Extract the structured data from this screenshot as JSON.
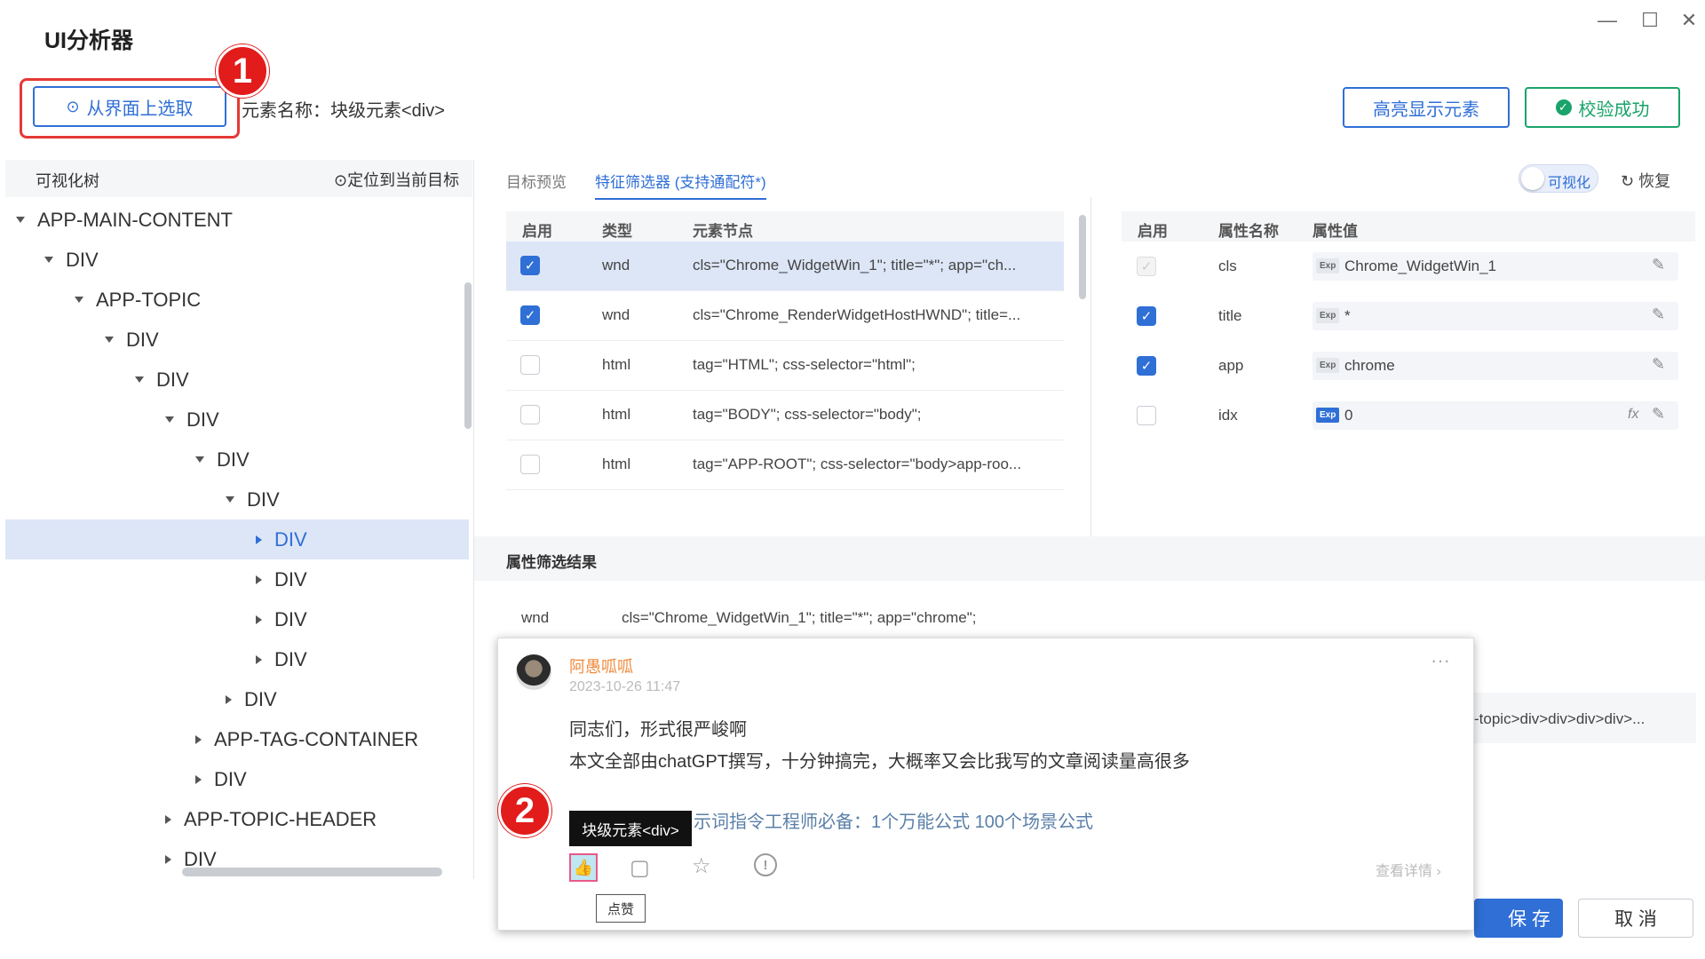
{
  "app_title": "UI分析器",
  "window_controls": [
    "—",
    "☐",
    "✕"
  ],
  "pick_button": "从界面上选取",
  "element_name": "元素名称：块级元素<div>",
  "highlight_button": "高亮显示元素",
  "verify_button": "校验成功",
  "markers": {
    "one": "1",
    "two": "2"
  },
  "tree": {
    "title": "可视化树",
    "locate": "定位到当前目标",
    "items": [
      {
        "label": "APP-MAIN-CONTENT",
        "caret": "down"
      },
      {
        "label": "DIV",
        "caret": "down"
      },
      {
        "label": "APP-TOPIC",
        "caret": "down"
      },
      {
        "label": "DIV",
        "caret": "down"
      },
      {
        "label": "DIV",
        "caret": "down"
      },
      {
        "label": "DIV",
        "caret": "down"
      },
      {
        "label": "DIV",
        "caret": "down"
      },
      {
        "label": "DIV",
        "caret": "down"
      },
      {
        "label": "DIV",
        "caret": "right",
        "selected": true
      },
      {
        "label": "DIV",
        "caret": "right"
      },
      {
        "label": "DIV",
        "caret": "right"
      },
      {
        "label": "DIV",
        "caret": "right"
      },
      {
        "label": "DIV",
        "caret": "right"
      },
      {
        "label": "APP-TAG-CONTAINER",
        "caret": "right"
      },
      {
        "label": "DIV",
        "caret": "right"
      },
      {
        "label": "APP-TOPIC-HEADER",
        "caret": "right"
      },
      {
        "label": "DIV",
        "caret": "right"
      }
    ]
  },
  "tabs": {
    "preview": "目标预览",
    "filter": "特征筛选器 (支持通配符*)"
  },
  "visualize_toggle": "可视化",
  "restore": "恢复",
  "node_table": {
    "headers": [
      "启用",
      "类型",
      "元素节点"
    ],
    "rows": [
      {
        "checked": true,
        "type": "wnd",
        "node": "cls=\"Chrome_WidgetWin_1\"; title=\"*\"; app=\"ch..."
      },
      {
        "checked": true,
        "type": "wnd",
        "node": "cls=\"Chrome_RenderWidgetHostHWND\"; title=..."
      },
      {
        "checked": false,
        "type": "html",
        "node": "tag=\"HTML\"; css-selector=\"html\";"
      },
      {
        "checked": false,
        "type": "html",
        "node": "tag=\"BODY\"; css-selector=\"body\";"
      },
      {
        "checked": false,
        "type": "html",
        "node": "tag=\"APP-ROOT\"; css-selector=\"body>app-roo..."
      }
    ]
  },
  "attr_table": {
    "headers": [
      "启用",
      "属性名称",
      "属性值"
    ],
    "rows": [
      {
        "state": "disabled",
        "name": "cls",
        "exp": "Exp",
        "value": "Chrome_WidgetWin_1"
      },
      {
        "state": "checked",
        "name": "title",
        "exp": "Exp",
        "value": "*"
      },
      {
        "state": "checked",
        "name": "app",
        "exp": "Exp",
        "value": "chrome"
      },
      {
        "state": "unchecked",
        "name": "idx",
        "exp": "Exp",
        "value": "0",
        "fx": "fx"
      }
    ]
  },
  "results": {
    "title": "属性筛选结果",
    "rows": [
      {
        "type": "wnd",
        "value": "cls=\"Chrome_WidgetWin_1\"; title=\"*\"; app=\"chrome\";"
      },
      {
        "type": "",
        "value": "-topic>div>div>div>div>..."
      }
    ]
  },
  "post": {
    "author": "阿愚呱呱",
    "time": "2023-10-26 11:47",
    "more": "···",
    "line1": "同志们，形式很严峻啊",
    "line2": "本文全部由chatGPT撰写，十分钟搞完，大概率又会比我写的文章阅读量高很多",
    "link": "示词指令工程师必备：1个万能公式 100个场景公式",
    "details": "查看详情",
    "tooltip": "块级元素<div>",
    "like_tip": "点赞"
  },
  "save_button": "保 存",
  "cancel_button": "取 消"
}
